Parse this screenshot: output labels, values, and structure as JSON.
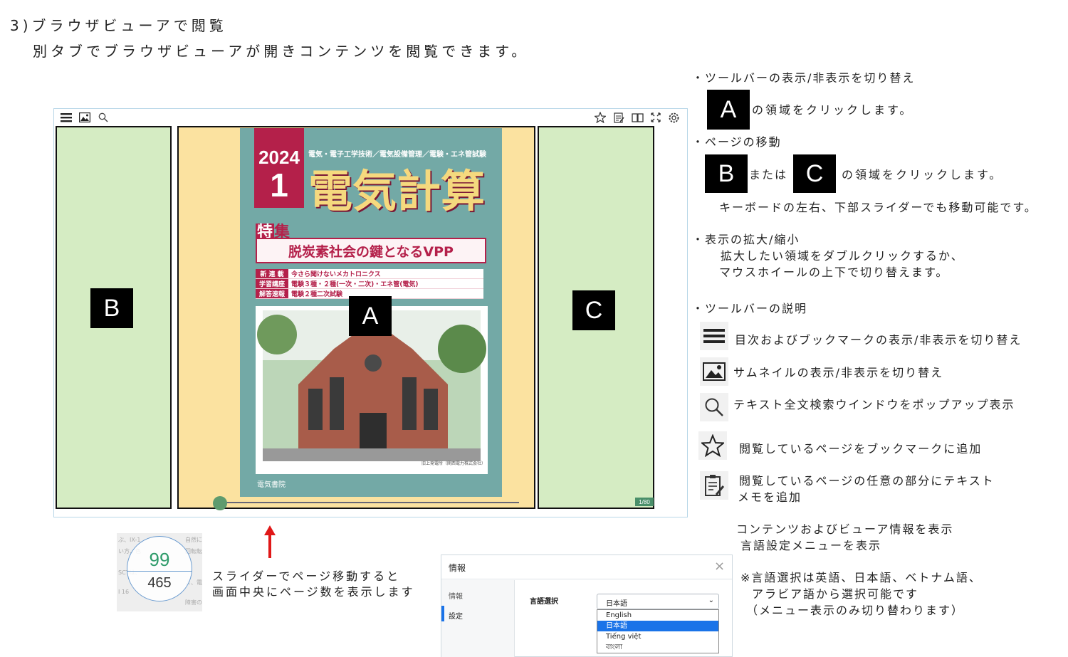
{
  "heading": {
    "step": "3)ブラウザビューアで閲覧",
    "desc": "別タブでブラウザビューアが開きコンテンツを閲覧できます。"
  },
  "viewer": {
    "toolbar_left": [
      "menu-icon",
      "thumbnail-icon",
      "search-icon"
    ],
    "toolbar_right": [
      "bookmark-star-icon",
      "memo-icon",
      "book-info-icon",
      "fullscreen-icon",
      "settings-gear-icon"
    ],
    "area_labels": {
      "a": "A",
      "b": "B",
      "c": "C"
    },
    "page_badge": "1/80",
    "slider_progress": 0.0,
    "cover": {
      "year": "2024",
      "month": "1",
      "title": "電気計算",
      "categories": "電気・電子工学技術／電気設備管理／電験・エネ管試験",
      "tokushu_1": "特",
      "tokushu_2": "集",
      "feature": "脱炭素社会の鍵となるVPP",
      "rows": [
        {
          "tag": "新 連 載",
          "text": "今さら聞けないメカトロニクス"
        },
        {
          "tag": "学習講座",
          "text": "電験３種・２種(一次・二次)・エネ管(電気)"
        },
        {
          "tag": "解答速報",
          "text": "電験２種二次試験"
        }
      ],
      "caption": "旧上発電所（関西電力株式会社）",
      "publisher": "電気書院"
    }
  },
  "slider_note": {
    "line1": "スライダーでページ移動すると",
    "line2": "画面中央にページ数を表示します"
  },
  "page_counter": {
    "current": "99",
    "total": "465"
  },
  "info_dialog": {
    "title": "情報",
    "close": "×",
    "side_items": [
      "情報",
      "設定"
    ],
    "language_label": "言語選択",
    "selected": "日本語",
    "options": [
      "English",
      "日本語",
      "Tiếng việt",
      "বাংলা"
    ]
  },
  "help": {
    "toolbar_toggle_title": "・ツールバーの表示/非表示を切り替え",
    "toolbar_toggle_desc": "の領域をクリックします。",
    "page_move_title": "・ページの移動",
    "page_move_or": "または",
    "page_move_desc": "の領域をクリックします。",
    "page_move_note": "キーボードの左右、下部スライダーでも移動可能です。",
    "zoom_title": "・表示の拡大/縮小",
    "zoom_line1": "拡大したい領域をダブルクリックするか、",
    "zoom_line2": "マウスホイールの上下で切り替えます。",
    "toolbar_desc_title": "・ツールバーの説明",
    "items": [
      {
        "icon": "menu-icon",
        "text": "目次およびブックマークの表示/非表示を切り替え"
      },
      {
        "icon": "thumbnail-icon",
        "text": "サムネイルの表示/非表示を切り替え"
      },
      {
        "icon": "search-icon",
        "text": "テキスト全文検索ウインドウをポップアップ表示"
      },
      {
        "icon": "bookmark-star-icon",
        "text": "閲覧しているページをブックマークに追加"
      },
      {
        "icon": "memo-icon",
        "text": "閲覧しているページの任意の部分にテキスト",
        "text2": "メモを追加"
      }
    ],
    "info_line1": "コンテンツおよびビューア情報を表示",
    "info_line2": "言語設定メニューを表示",
    "lang_note1": "※言語選択は英語、日本語、ベトナム語、",
    "lang_note2": "アラビア語から選択可能です",
    "lang_note3": "（メニュー表示のみ切り替わります）"
  }
}
